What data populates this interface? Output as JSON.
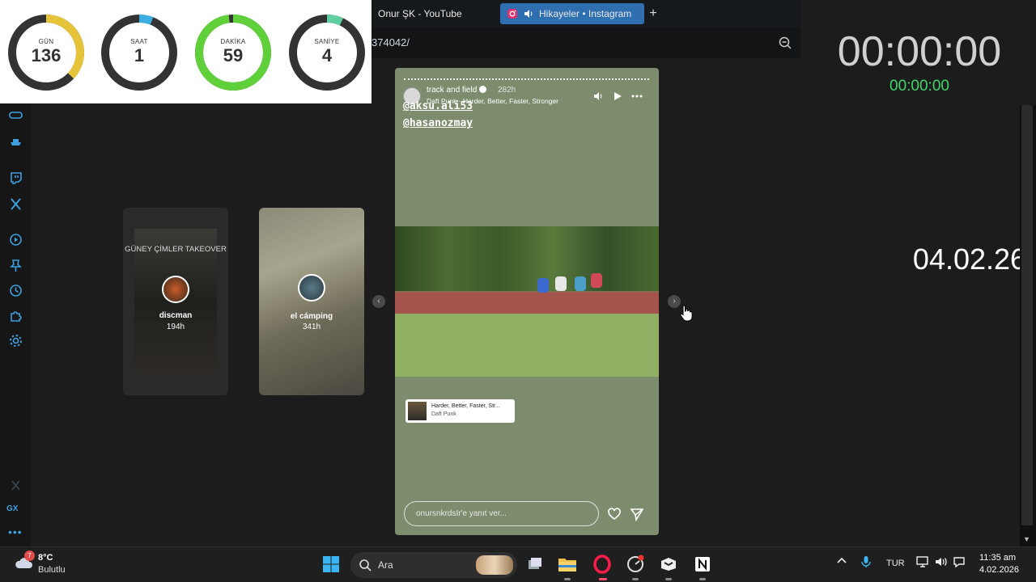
{
  "browser": {
    "tabs": [
      {
        "label": "Onur ŞK - YouTube"
      },
      {
        "label": "Hikayeler • Instagram"
      }
    ],
    "new_tab": "+",
    "address": "374042/"
  },
  "countdown": {
    "rings": [
      {
        "label": "GÜN",
        "value": "136",
        "progress": 0.37,
        "color": "#e6c43a"
      },
      {
        "label": "SAAT",
        "value": "1",
        "progress": 0.06,
        "color": "#3aaede"
      },
      {
        "label": "DAKİKA",
        "value": "59",
        "progress": 0.98,
        "color": "#5fcf3a"
      },
      {
        "label": "SANİYE",
        "value": "4",
        "progress": 0.07,
        "color": "#5fcfa0"
      }
    ]
  },
  "overlay": {
    "timer_main": "00:00:00",
    "timer_sub": "00:00:00",
    "date": "04.02.26"
  },
  "stories": {
    "previous": [
      {
        "title": "GÜNEY ÇİMLER TAKEOVER",
        "name": "discman",
        "age": "194h"
      },
      {
        "name": "el cámping",
        "age": "341h"
      }
    ],
    "current": {
      "user": "track and field",
      "age": "282h",
      "song": "Daft Punk · Harder, Better, Faster, Stronger",
      "mentions": [
        "@aksu.ali53",
        "@hasanozmay"
      ],
      "sticker_title": "Harder, Better, Faster, Str...",
      "sticker_artist": "Daft Punk",
      "reply_placeholder": "onursnkrdsIr'e yanıt ver..."
    }
  },
  "sidebar": {
    "gx_label": "GX",
    "more": "•••"
  },
  "taskbar": {
    "weather_badge": "7",
    "temperature": "8°C",
    "condition": "Bulutlu",
    "search_label": "Ara",
    "lang": "TUR",
    "time": "11:35 am",
    "date": "4.02.2026"
  }
}
